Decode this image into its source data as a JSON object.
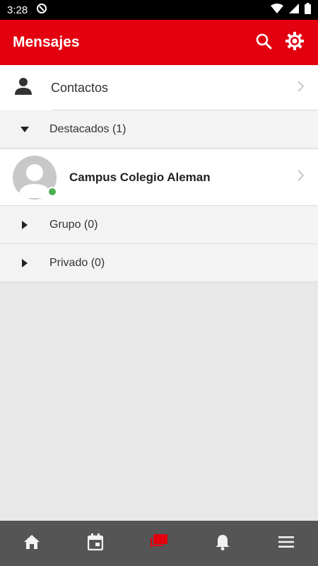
{
  "status_bar": {
    "time": "3:28"
  },
  "app_bar": {
    "title": "Mensajes"
  },
  "contacts": {
    "label": "Contactos"
  },
  "sections": {
    "destacados": {
      "label": "Destacados (1)",
      "expanded": true
    },
    "grupo": {
      "label": "Grupo (0)",
      "expanded": false
    },
    "privado": {
      "label": "Privado (0)",
      "expanded": false
    }
  },
  "conversations": [
    {
      "name": "Campus Colegio Aleman",
      "online": true
    }
  ],
  "bottom_nav": {
    "items": [
      {
        "icon": "home-icon",
        "active": false
      },
      {
        "icon": "calendar-icon",
        "active": false
      },
      {
        "icon": "messages-icon",
        "active": true
      },
      {
        "icon": "bell-icon",
        "active": false
      },
      {
        "icon": "menu-icon",
        "active": false
      }
    ]
  },
  "colors": {
    "brand_red": "#e3000f",
    "online_green": "#4caf50",
    "nav_background": "#555555"
  }
}
